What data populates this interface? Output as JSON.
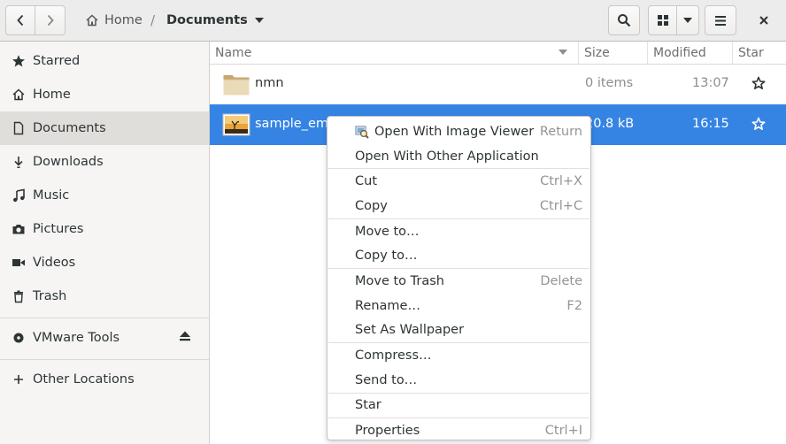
{
  "header": {
    "breadcrumb_home": "Home",
    "breadcrumb_separator": "/",
    "breadcrumb_current": "Documents"
  },
  "sidebar": {
    "items": [
      {
        "label": "Starred",
        "icon": "star-icon"
      },
      {
        "label": "Home",
        "icon": "home-icon"
      },
      {
        "label": "Documents",
        "icon": "document-icon",
        "active": true
      },
      {
        "label": "Downloads",
        "icon": "download-icon"
      },
      {
        "label": "Music",
        "icon": "music-icon"
      },
      {
        "label": "Pictures",
        "icon": "camera-icon"
      },
      {
        "label": "Videos",
        "icon": "video-icon"
      },
      {
        "label": "Trash",
        "icon": "trash-icon"
      }
    ],
    "devices": [
      {
        "label": "VMware Tools",
        "icon": "disc-icon",
        "eject": true
      }
    ],
    "other": {
      "label": "Other Locations",
      "icon": "plus-icon"
    }
  },
  "columns": {
    "name": "Name",
    "size": "Size",
    "modified": "Modified",
    "star": "Star"
  },
  "files": [
    {
      "name": "nmn",
      "size": "0 items",
      "modified": "13:07",
      "type": "folder",
      "starred": false,
      "selected": false
    },
    {
      "name": "sample_emb",
      "size": "20.8 kB",
      "modified": "16:15",
      "type": "image",
      "starred": false,
      "selected": true
    }
  ],
  "context_menu": {
    "groups": [
      [
        {
          "label": "Open With Image Viewer",
          "accel": "Return",
          "icon": "image-viewer-icon"
        },
        {
          "label": "Open With Other Application",
          "accel": ""
        }
      ],
      [
        {
          "label": "Cut",
          "accel": "Ctrl+X"
        },
        {
          "label": "Copy",
          "accel": "Ctrl+C"
        }
      ],
      [
        {
          "label": "Move to…",
          "accel": ""
        },
        {
          "label": "Copy to…",
          "accel": ""
        }
      ],
      [
        {
          "label": "Move to Trash",
          "accel": "Delete"
        },
        {
          "label": "Rename…",
          "accel": "F2"
        },
        {
          "label": "Set As Wallpaper",
          "accel": ""
        }
      ],
      [
        {
          "label": "Compress…",
          "accel": ""
        },
        {
          "label": "Send to…",
          "accel": ""
        }
      ],
      [
        {
          "label": "Star",
          "accel": ""
        }
      ],
      [
        {
          "label": "Properties",
          "accel": "Ctrl+I"
        }
      ]
    ]
  },
  "colors": {
    "selection": "#3584e4",
    "sidebar_bg": "#f6f5f4",
    "sidebar_active": "#e0dedb",
    "headerbar_bg": "#ececec",
    "text": "#2e3436",
    "muted_text": "#8b8e8f"
  }
}
